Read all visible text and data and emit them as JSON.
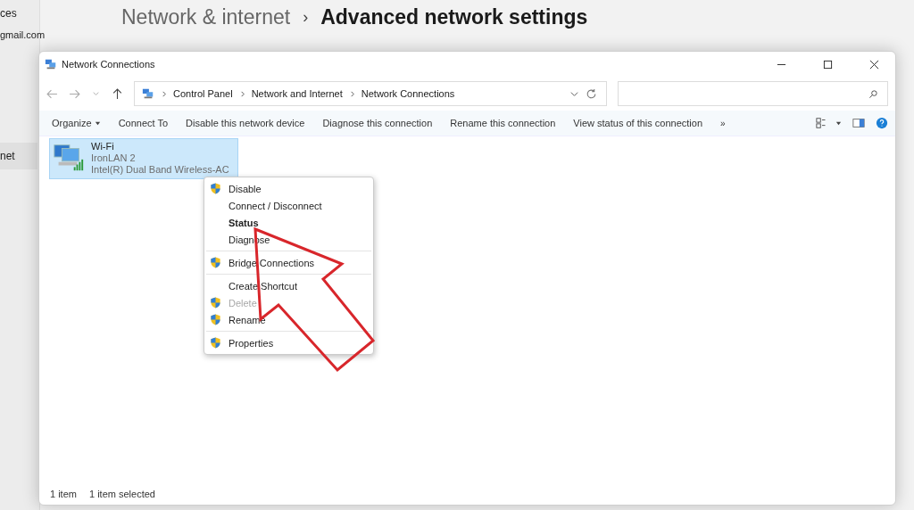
{
  "background": {
    "account": "gmail.com",
    "breadcrumb": [
      {
        "text": "Network & internet",
        "current": false
      },
      {
        "text": "Advanced network settings",
        "current": true
      }
    ],
    "separator": "›",
    "sidebar_items": [
      {
        "label": "ces",
        "selected": false
      },
      {
        "label": "net",
        "selected": true
      }
    ]
  },
  "window": {
    "title": "Network Connections"
  },
  "address_bar": {
    "path": [
      "Control Panel",
      "Network and Internet",
      "Network Connections"
    ]
  },
  "toolbar": [
    {
      "label": "Organize",
      "kind": "menu"
    },
    {
      "label": "Connect To",
      "kind": "button"
    },
    {
      "label": "Disable this network device",
      "kind": "button"
    },
    {
      "label": "Diagnose this connection",
      "kind": "button"
    },
    {
      "label": "Rename this connection",
      "kind": "button"
    },
    {
      "label": "View status of this connection",
      "kind": "button"
    },
    {
      "label": "»",
      "kind": "more"
    }
  ],
  "connections": [
    {
      "name": "Wi-Fi",
      "network": "IronLAN 2",
      "adapter": "Intel(R) Dual Band Wireless-AC",
      "selected": true
    }
  ],
  "context_menu": [
    [
      {
        "label": "Disable",
        "shield": true,
        "default": false,
        "disabled": false
      },
      {
        "label": "Connect / Disconnect",
        "shield": false,
        "default": false,
        "disabled": false
      },
      {
        "label": "Status",
        "shield": false,
        "default": true,
        "disabled": false
      },
      {
        "label": "Diagnose",
        "shield": false,
        "default": false,
        "disabled": false
      }
    ],
    [
      {
        "label": "Bridge Connections",
        "shield": true,
        "default": false,
        "disabled": false
      }
    ],
    [
      {
        "label": "Create Shortcut",
        "shield": false,
        "default": false,
        "disabled": false
      },
      {
        "label": "Delete",
        "shield": true,
        "default": false,
        "disabled": true
      },
      {
        "label": "Rename",
        "shield": true,
        "default": false,
        "disabled": false
      }
    ],
    [
      {
        "label": "Properties",
        "shield": true,
        "default": false,
        "disabled": false
      }
    ]
  ],
  "status_bar": [
    "1 item",
    "1 item selected"
  ]
}
